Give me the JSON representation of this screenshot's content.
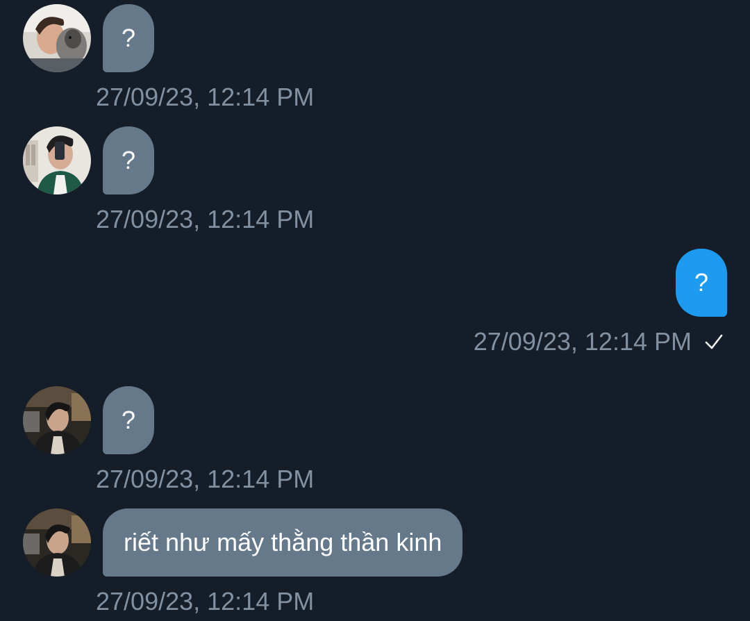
{
  "messages": [
    {
      "direction": "incoming",
      "avatar": "avatar-man-with-dog",
      "text": "?",
      "timestamp": "27/09/23, 12:14 PM"
    },
    {
      "direction": "incoming",
      "avatar": "avatar-mirror-selfie",
      "text": "?",
      "timestamp": "27/09/23, 12:14 PM"
    },
    {
      "direction": "outgoing",
      "text": "?",
      "timestamp": "27/09/23, 12:14 PM",
      "status_icon": "check-icon"
    },
    {
      "direction": "incoming",
      "avatar": "avatar-street-photo",
      "text": "?",
      "timestamp": "27/09/23, 12:14 PM"
    },
    {
      "direction": "incoming",
      "avatar": "avatar-street-photo",
      "text": "riết như mấy thằng thần kinh",
      "timestamp": "27/09/23, 12:14 PM"
    }
  ],
  "colors": {
    "background": "#151d29",
    "incoming_bubble": "#66798a",
    "outgoing_bubble": "#1d9bf0",
    "timestamp": "#8291a1",
    "text": "#ffffff"
  }
}
